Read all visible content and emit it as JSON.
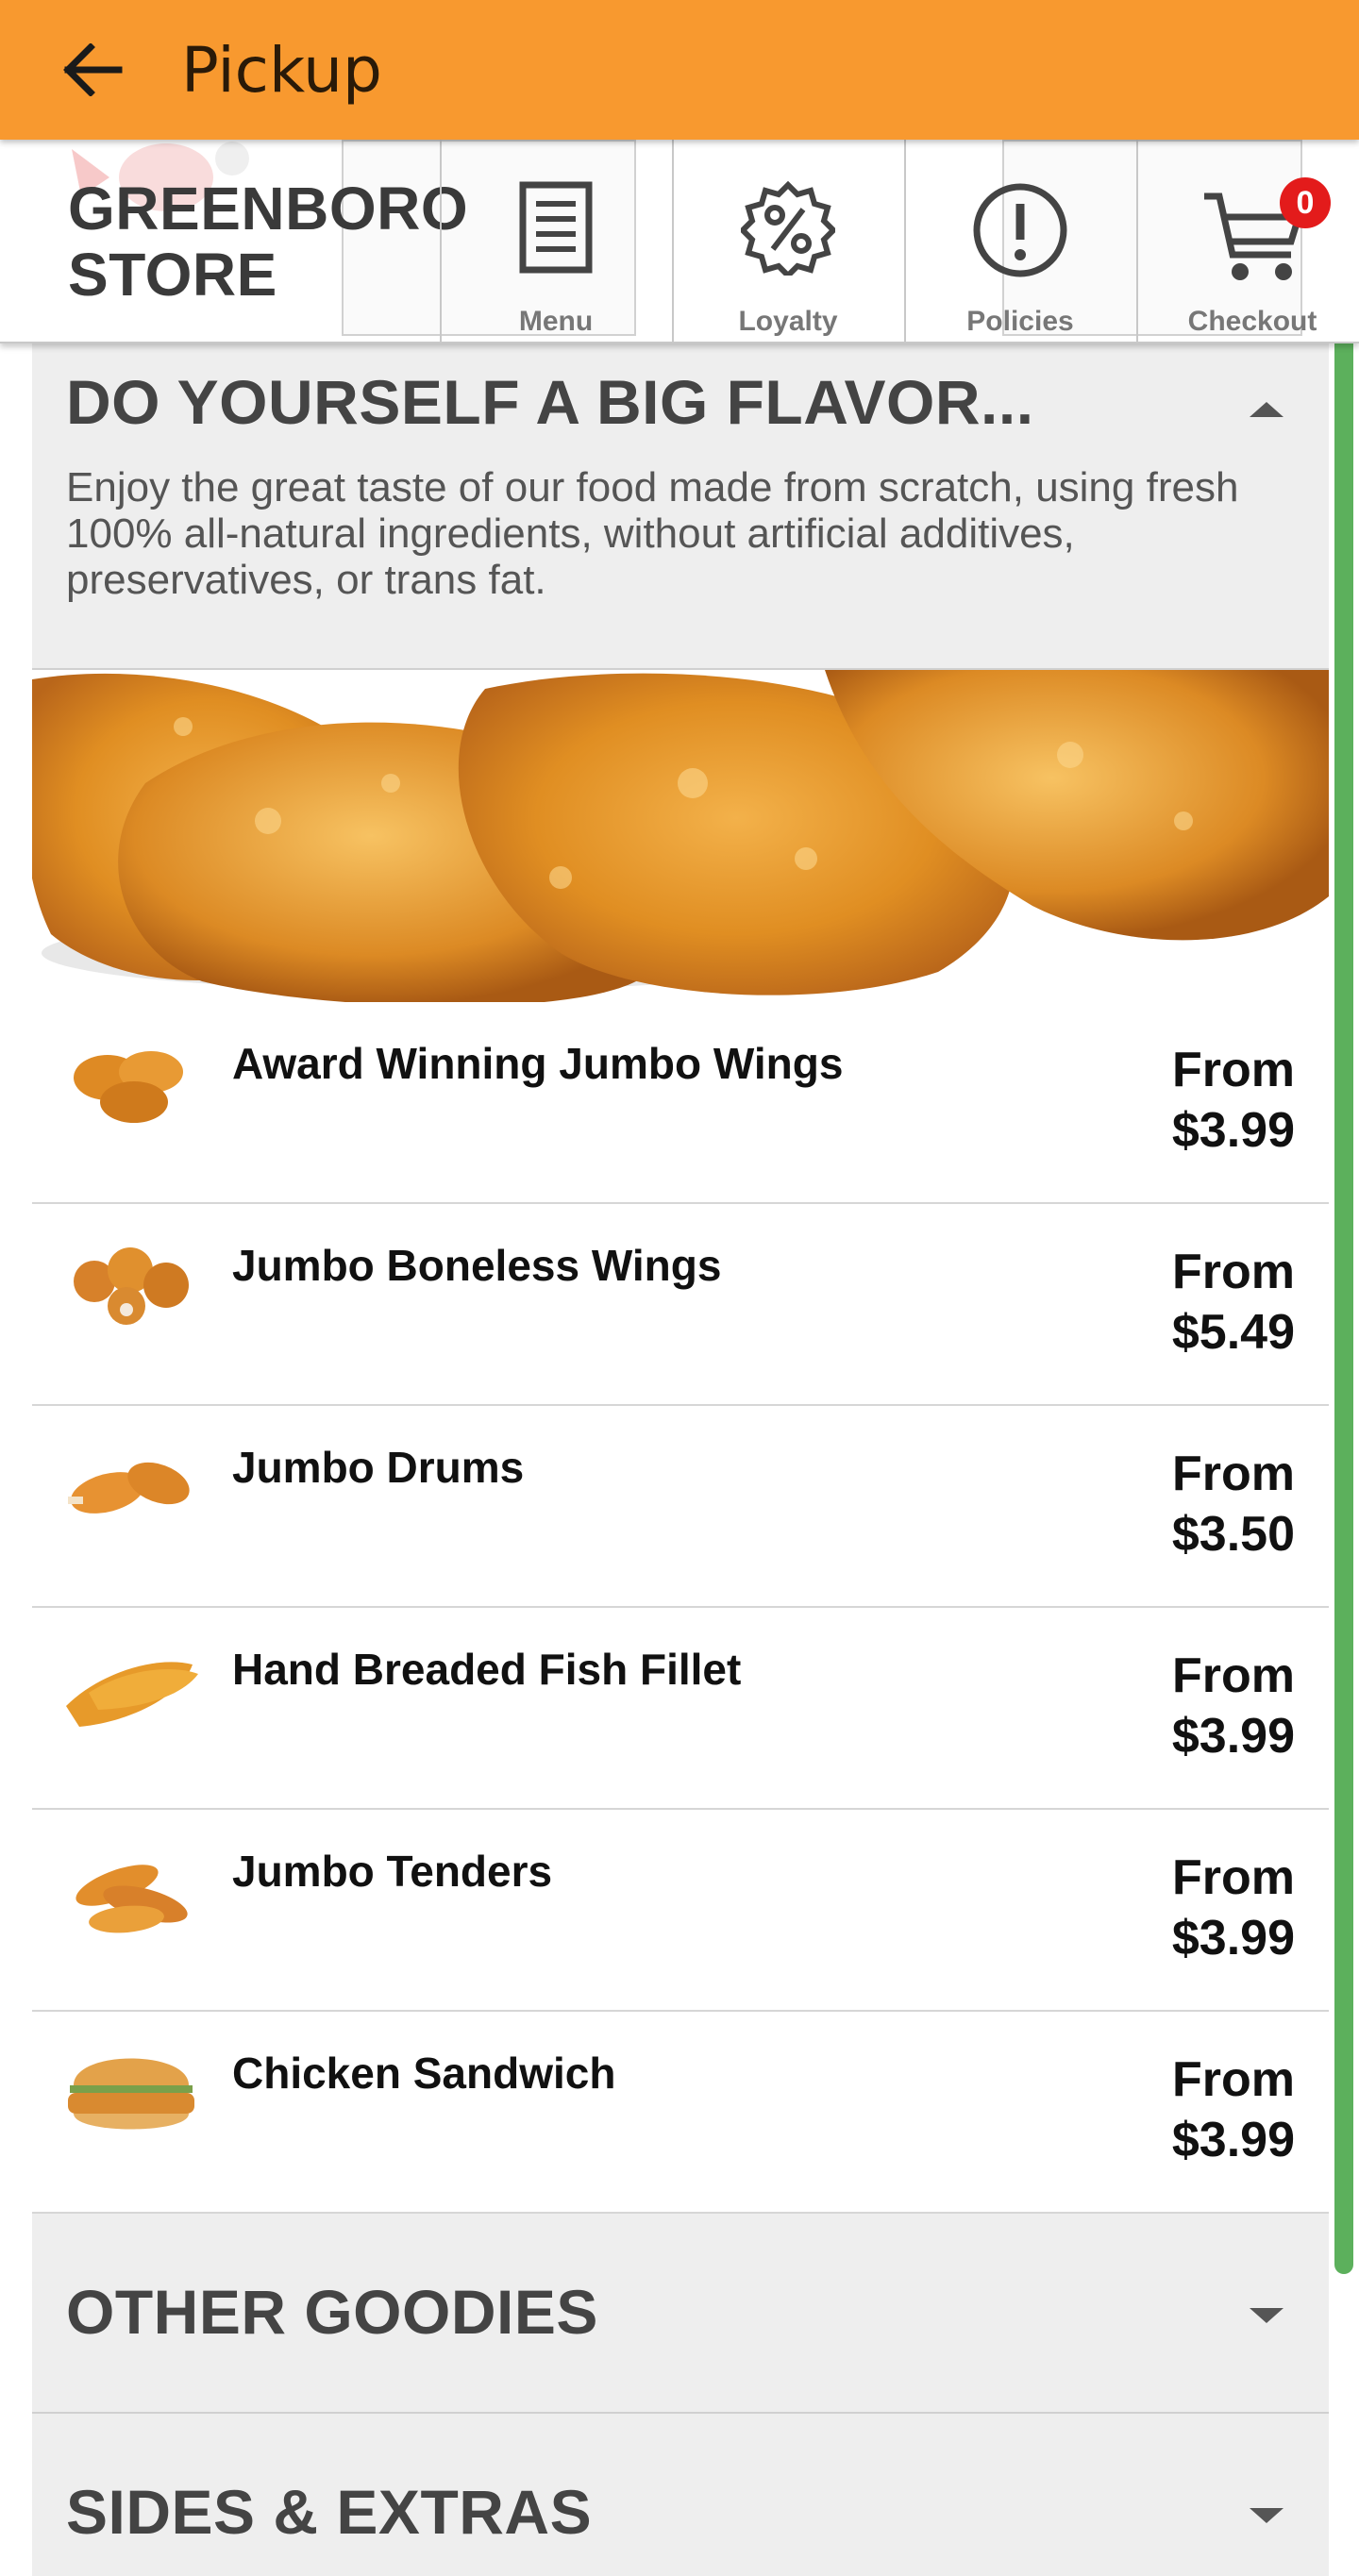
{
  "app_bar": {
    "title": "Pickup",
    "back_icon": "arrow-left-icon",
    "background_color": "#f8992f"
  },
  "store": {
    "name_line1": "GREENBORO",
    "name_line2": "STORE"
  },
  "nav_tabs": [
    {
      "label": "Menu",
      "icon": "menu-document-icon"
    },
    {
      "label": "Loyalty",
      "icon": "percent-badge-icon"
    },
    {
      "label": "Policies",
      "icon": "exclamation-circle-icon"
    },
    {
      "label": "Checkout",
      "icon": "shopping-cart-icon",
      "badge": "0"
    }
  ],
  "sections": [
    {
      "title": "DO YOURSELF A BIG FLAVOR...",
      "description": "Enjoy the great taste of our food made from scratch, using fresh 100% all-natural ingredients, without artificial additives, preservatives, or trans fat.",
      "expanded": true
    },
    {
      "title": "OTHER GOODIES",
      "expanded": false
    },
    {
      "title": "SIDES & EXTRAS",
      "expanded": false
    }
  ],
  "items": [
    {
      "name": "Award Winning Jumbo Wings",
      "price_prefix": "From",
      "price": "$3.99"
    },
    {
      "name": "Jumbo Boneless Wings",
      "price_prefix": "From",
      "price": "$5.49"
    },
    {
      "name": "Jumbo Drums",
      "price_prefix": "From",
      "price": "$3.50"
    },
    {
      "name": "Hand Breaded Fish Fillet",
      "price_prefix": "From",
      "price": "$3.99"
    },
    {
      "name": "Jumbo Tenders",
      "price_prefix": "From",
      "price": "$3.99"
    },
    {
      "name": "Chicken Sandwich",
      "price_prefix": "From",
      "price": "$3.99"
    }
  ],
  "colors": {
    "accent": "#f8992f",
    "scroll_indicator": "#5cb05c",
    "badge": "#e31b1b",
    "section_bg": "#eeeeee"
  }
}
